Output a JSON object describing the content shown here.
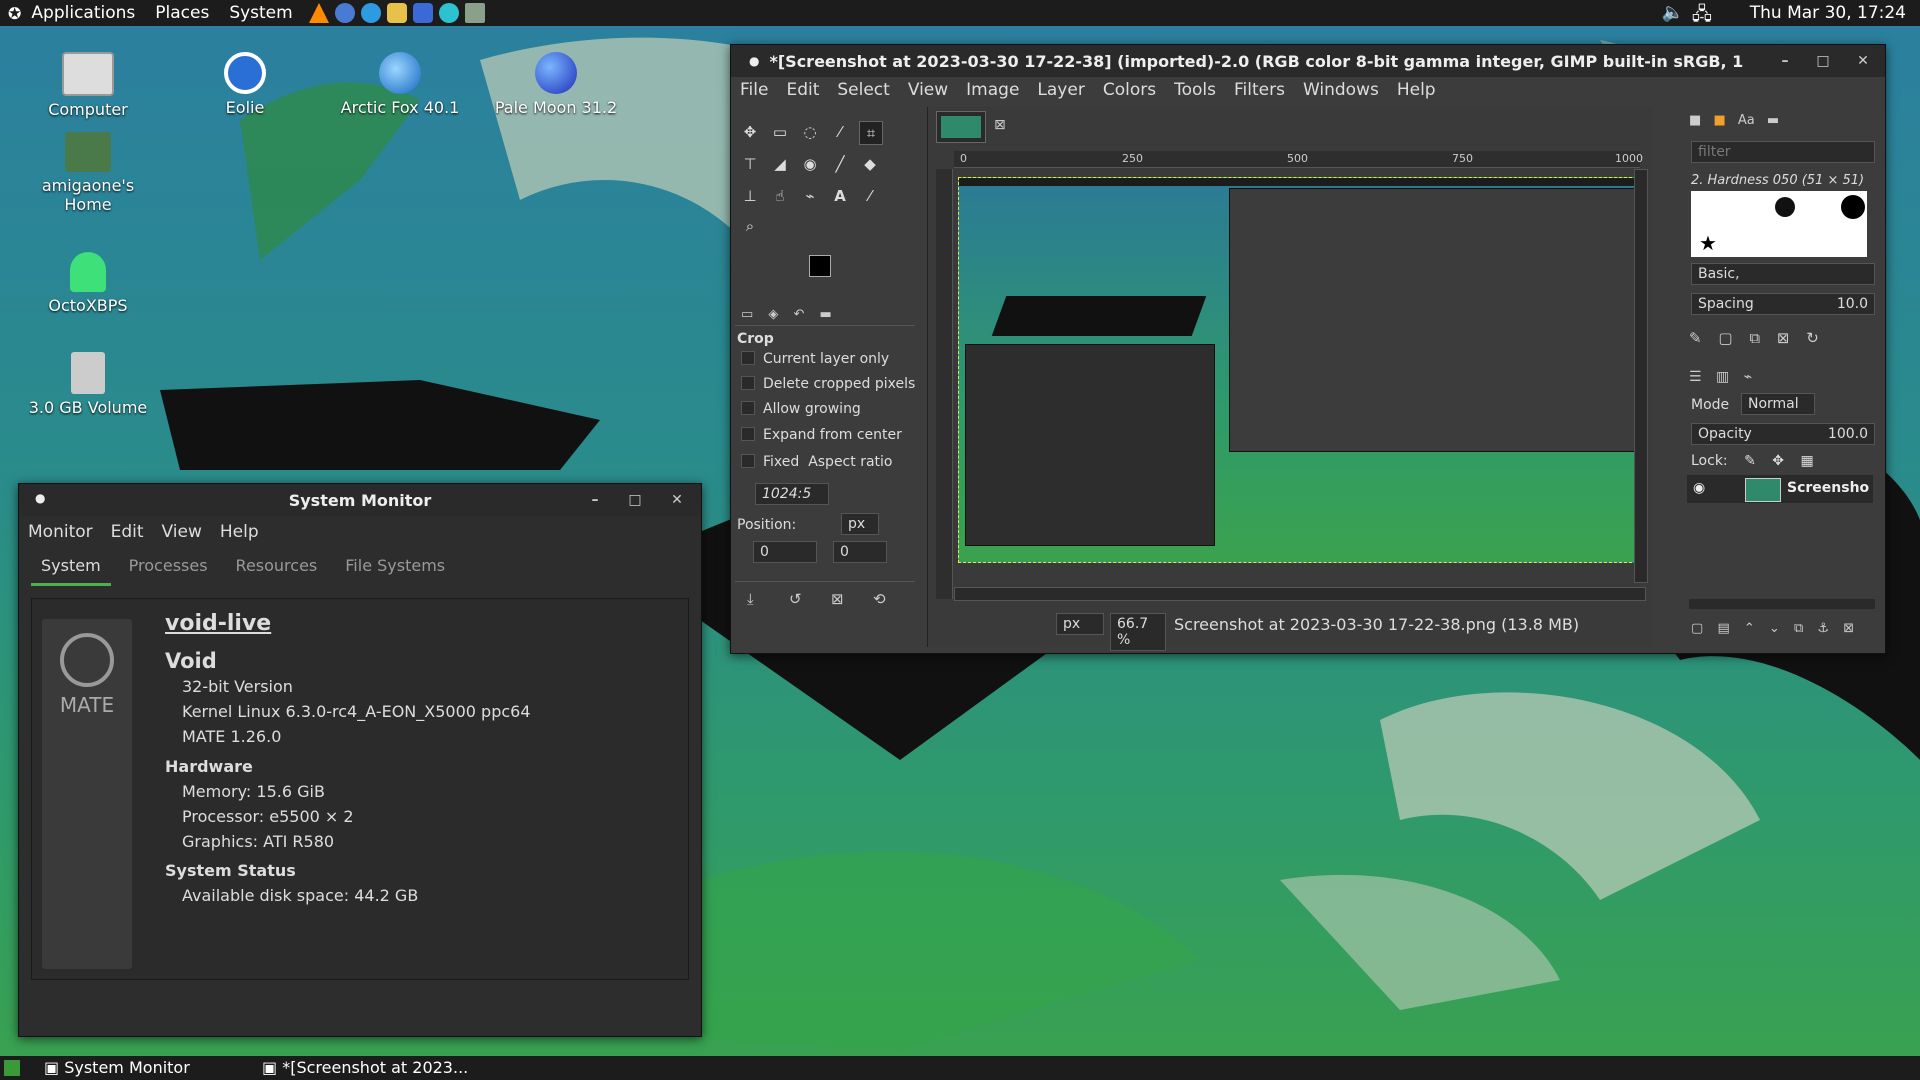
{
  "top_panel": {
    "menus": [
      "Applications",
      "Places",
      "System"
    ],
    "clock": "Thu Mar 30, 17:24"
  },
  "desktop_icons": [
    {
      "label": "Computer",
      "icon": "computer-icon"
    },
    {
      "label": "Eolie",
      "icon": "eolie-browser-icon"
    },
    {
      "label": "Arctic Fox 40.1",
      "icon": "arctic-fox-icon"
    },
    {
      "label": "Pale Moon 31.2",
      "icon": "pale-moon-icon"
    },
    {
      "label": "amigaone's Home",
      "icon": "home-folder-icon"
    },
    {
      "label": "OctoXBPS",
      "icon": "octoxbps-icon"
    },
    {
      "label": "3.0 GB Volume",
      "icon": "sd-card-icon"
    }
  ],
  "system_monitor": {
    "title": "System Monitor",
    "menus": [
      "Monitor",
      "Edit",
      "View",
      "Help"
    ],
    "tabs": [
      "System",
      "Processes",
      "Resources",
      "File Systems"
    ],
    "logo_text": "MATE",
    "hostname": "void-live",
    "distro": "Void",
    "version": "32-bit Version",
    "kernel": "Kernel Linux 6.3.0-rc4_A-EON_X5000 ppc64",
    "mate": "MATE 1.26.0",
    "hardware_heading": "Hardware",
    "memory": "Memory:   15.6 GiB",
    "processor": "Processor:  e5500 × 2",
    "graphics": "Graphics:  ATI R580",
    "status_heading": "System Status",
    "disk": "Available disk space: 44.2 GB"
  },
  "gimp": {
    "title": "*[Screenshot at 2023-03-30 17-22-38] (imported)-2.0 (RGB color 8-bit gamma integer, GIMP built-in sRGB, 1",
    "menus": [
      "File",
      "Edit",
      "Select",
      "View",
      "Image",
      "Layer",
      "Colors",
      "Tools",
      "Filters",
      "Windows",
      "Help"
    ],
    "tool_options_title": "Crop",
    "options": [
      "Current layer only",
      "Delete cropped pixels",
      "Allow growing",
      "Expand from center"
    ],
    "fixed_label": "Fixed",
    "aspect_label": "Aspect ratio",
    "ratio_value": "1024:5",
    "position_label": "Position:",
    "position_unit": "px",
    "position_x": "0",
    "position_y": "0",
    "ruler_ticks": [
      "0",
      "250",
      "500",
      "750",
      "1000"
    ],
    "unit_select": "px",
    "zoom": "66.7 %",
    "status": "Screenshot at 2023-03-30 17-22-38.png (13.8 MB)",
    "brush_filter_placeholder": "filter",
    "brush_name": "2. Hardness 050 (51 × 51)",
    "brush_set": "Basic,",
    "spacing_label": "Spacing",
    "spacing_value": "10.0",
    "mode_label": "Mode",
    "mode_value": "Normal",
    "opacity_label": "Opacity",
    "opacity_value": "100.0",
    "lock_label": "Lock:",
    "layer_name": "Screensho"
  },
  "taskbar": {
    "items": [
      "System Monitor",
      "*[Screenshot at 2023..."
    ]
  }
}
